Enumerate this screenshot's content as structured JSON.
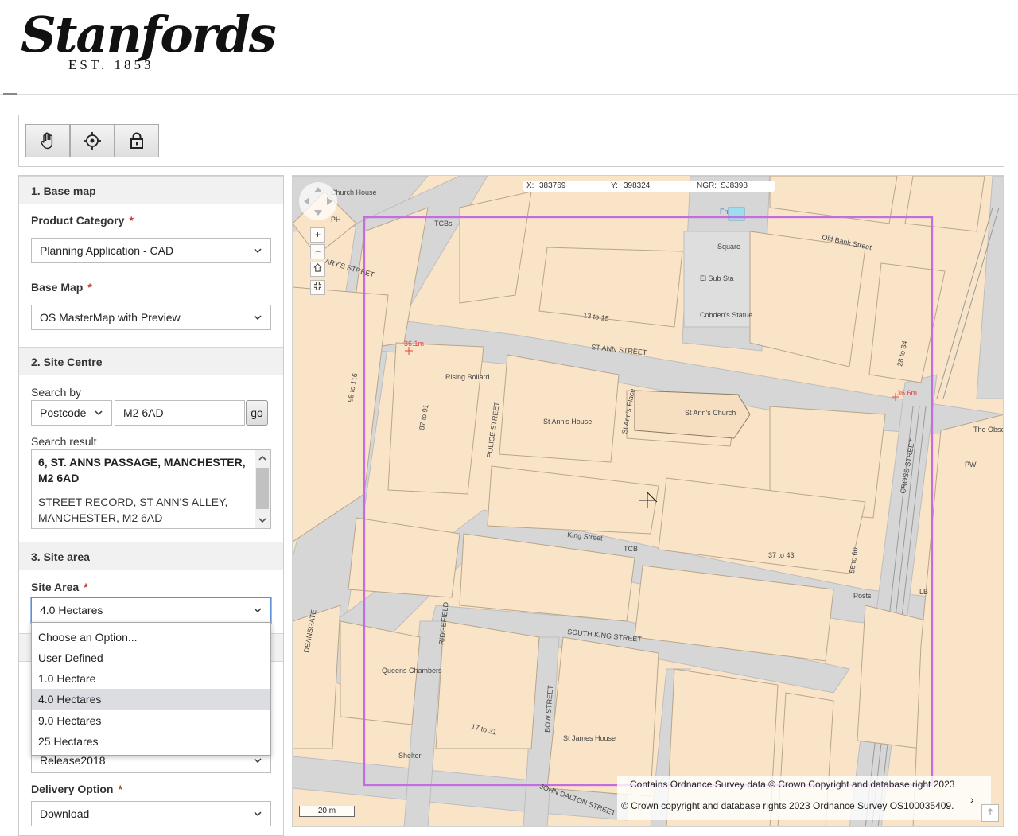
{
  "header": {
    "logo_text": "Stanfords",
    "logo_est": "EST. 1853"
  },
  "toolbar": {
    "tools": [
      {
        "name": "pan-hand-icon"
      },
      {
        "name": "locate-target-icon"
      },
      {
        "name": "lock-icon"
      }
    ]
  },
  "panel": {
    "base_map_section": "1. Base map",
    "product_category_label": "Product Category",
    "product_category_value": "Planning Application - CAD",
    "base_map_label": "Base Map",
    "base_map_value": "OS MasterMap with Preview",
    "site_centre_section": "2. Site Centre",
    "search_by_label": "Search by",
    "search_by_value": "Postcode",
    "search_input_value": "M2 6AD",
    "go_label": "go",
    "search_result_label": "Search result",
    "results": [
      {
        "text": "6, ST. ANNS PASSAGE, MANCHESTER, M2 6AD",
        "line1": "6, ST. ANNS PASSAGE, MANCHESTER,",
        "line2": "M2 6AD"
      },
      {
        "text": "STREET RECORD, ST ANN'S ALLEY, MANCHESTER, M2 6AD",
        "line1": "STREET RECORD, ST ANN'S ALLEY,",
        "line2": "MANCHESTER, M2 6AD"
      }
    ],
    "site_area_section": "3. Site area",
    "site_area_label": "Site Area",
    "site_area_value": "4.0 Hectares",
    "site_area_options": [
      "Choose an Option...",
      "User Defined",
      "1.0 Hectare",
      "4.0 Hectares",
      "9.0 Hectares",
      "25 Hectares"
    ],
    "site_area_selected_index": 3,
    "release_value": "Release2018",
    "delivery_label": "Delivery Option",
    "delivery_value": "Download",
    "required_mark": "*"
  },
  "map": {
    "coords": {
      "x_label": "X:",
      "x": "383769",
      "y_label": "Y:",
      "y": "398324",
      "ngr_label": "NGR:",
      "ngr": "SJ8398"
    },
    "zoom_in": "+",
    "zoom_out": "−",
    "attribution_1": "Contains Ordnance Survey data © Crown Copyright and database right 2023",
    "attribution_2": "© Crown copyright and database rights 2023 Ordnance Survey OS100035409.",
    "scale_label": "20 m",
    "street_labels": [
      "ST ANN STREET",
      "King Street",
      "SOUTH KING STREET",
      "JOHN DALTON STREET",
      "CROSS STREET",
      "POLICE STREET",
      "RIDGEFIELD",
      "BOW STREET",
      "DEANSGATE",
      "Old Bank Street",
      "St Ann's Place",
      "ARY'S STREET"
    ],
    "place_labels": [
      "St Ann's House",
      "St Ann's Church",
      "St James House",
      "Rising Bollard",
      "Square",
      "El Sub Sta",
      "Cobden's Statue",
      "Queens Chambers",
      "The Obse",
      "Shelter",
      "TCBs",
      "TCB",
      "PH",
      "PW",
      "Posts",
      "LB",
      "Church House",
      "36.1m",
      "36.6m",
      "98 to 116",
      "87 to 91",
      "37 to 43",
      "17 to 31",
      "13 to 15",
      "28 to 34",
      "56 to 60",
      "Fn"
    ],
    "accent_color": "#c36ee0"
  }
}
